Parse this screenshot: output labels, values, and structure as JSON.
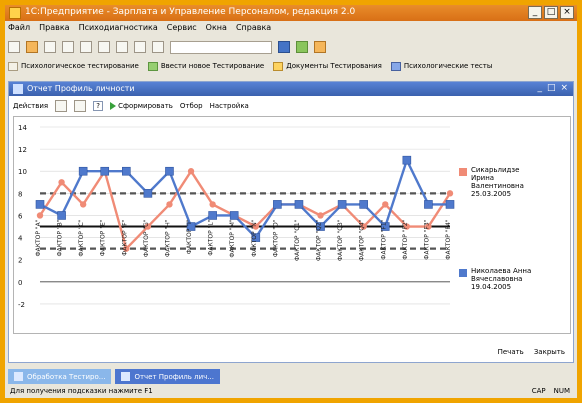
{
  "window": {
    "title": "1С:Предприятие - Зарплата и Управление Персоналом, редакция 2.0",
    "controls": [
      "_",
      "□",
      "×"
    ]
  },
  "menu": [
    "Файл",
    "Правка",
    "Психодиагностика",
    "Сервис",
    "Окна",
    "Справка"
  ],
  "quickbar": [
    "Психологическое тестирование",
    "Ввести новое Тестирование",
    "Документы Тестирования",
    "Психологические тесты"
  ],
  "report": {
    "title": "Отчет Профиль личности",
    "toolbar": [
      "Действия",
      "?",
      "Сформировать",
      "Отбор",
      "Настройка"
    ],
    "actions": [
      "Печать",
      "Закрыть"
    ]
  },
  "taskbar": [
    {
      "label": "Обработка Тестиро...",
      "active": false
    },
    {
      "label": "Отчет Профиль лич...",
      "active": true
    }
  ],
  "status": {
    "left": "Для получения подсказки нажмите F1",
    "right": [
      "CAP",
      "NUM"
    ]
  },
  "colors": {
    "blue": "#4f79cc",
    "salmon": "#f08b76",
    "orange": "#f0a400"
  },
  "chart_data": {
    "type": "line",
    "categories": [
      "ФАКТОР \"A\"",
      "ФАКТОР \"B\"",
      "ФАКТОР \"C\"",
      "ФАКТОР \"E\"",
      "ФАКТОР \"F\"",
      "ФАКТОР \"G\"",
      "ФАКТОР \"H\"",
      "ФАКТОР \"I\"",
      "ФАКТОР \"L\"",
      "ФАКТОР \"M\"",
      "ФАКТОР \"N\"",
      "ФАКТОР \"O\"",
      "ФАКТОР \"Q1\"",
      "ФАКТОР \"Q2\"",
      "ФАКТОР \"Q3\"",
      "ФАКТОР \"Q4\"",
      "ФАКТОР \"F1\"",
      "ФАКТОР \"F2\"",
      "ФАКТОР \"F3\"",
      "ФАКТОР \"F4\""
    ],
    "ylim": [
      -3,
      14
    ],
    "yticks": [
      14,
      12,
      10,
      8,
      6,
      4,
      2,
      0,
      -2
    ],
    "hlines": [
      8,
      5,
      3
    ],
    "series": [
      {
        "name": "Сикарьлидзе Ирина Валентиновна 25.03.2005",
        "color": "#f08b76",
        "marker": "circle",
        "values": [
          6,
          9,
          7,
          10,
          3,
          5,
          7,
          10,
          7,
          6,
          5,
          7,
          7,
          6,
          7,
          5,
          7,
          5,
          5,
          8
        ]
      },
      {
        "name": "Николаева Анна Вячеславовна 19.04.2005",
        "color": "#4f79cc",
        "marker": "square",
        "values": [
          7,
          6,
          10,
          10,
          10,
          8,
          10,
          5,
          6,
          6,
          4,
          7,
          7,
          5,
          7,
          7,
          5,
          11,
          7,
          7
        ]
      }
    ]
  }
}
